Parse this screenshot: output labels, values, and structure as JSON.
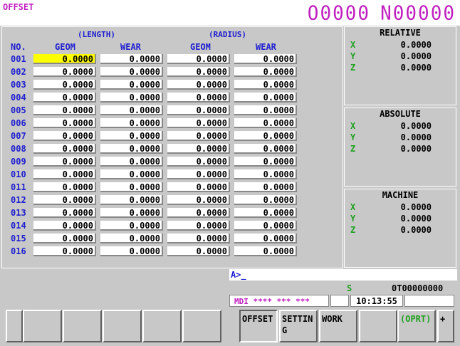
{
  "screen_title": "OFFSET",
  "program_number": "O0000",
  "sequence_number": "N00000",
  "headers": {
    "length": "(LENGTH)",
    "radius": "(RADIUS)",
    "no": "NO.",
    "geom1": "GEOM",
    "wear1": "WEAR",
    "geom2": "GEOM",
    "wear2": "WEAR"
  },
  "rows": [
    {
      "no": "001",
      "v": [
        "0.0000",
        "0.0000",
        "0.0000",
        "0.0000"
      ]
    },
    {
      "no": "002",
      "v": [
        "0.0000",
        "0.0000",
        "0.0000",
        "0.0000"
      ]
    },
    {
      "no": "003",
      "v": [
        "0.0000",
        "0.0000",
        "0.0000",
        "0.0000"
      ]
    },
    {
      "no": "004",
      "v": [
        "0.0000",
        "0.0000",
        "0.0000",
        "0.0000"
      ]
    },
    {
      "no": "005",
      "v": [
        "0.0000",
        "0.0000",
        "0.0000",
        "0.0000"
      ]
    },
    {
      "no": "006",
      "v": [
        "0.0000",
        "0.0000",
        "0.0000",
        "0.0000"
      ]
    },
    {
      "no": "007",
      "v": [
        "0.0000",
        "0.0000",
        "0.0000",
        "0.0000"
      ]
    },
    {
      "no": "008",
      "v": [
        "0.0000",
        "0.0000",
        "0.0000",
        "0.0000"
      ]
    },
    {
      "no": "009",
      "v": [
        "0.0000",
        "0.0000",
        "0.0000",
        "0.0000"
      ]
    },
    {
      "no": "010",
      "v": [
        "0.0000",
        "0.0000",
        "0.0000",
        "0.0000"
      ]
    },
    {
      "no": "011",
      "v": [
        "0.0000",
        "0.0000",
        "0.0000",
        "0.0000"
      ]
    },
    {
      "no": "012",
      "v": [
        "0.0000",
        "0.0000",
        "0.0000",
        "0.0000"
      ]
    },
    {
      "no": "013",
      "v": [
        "0.0000",
        "0.0000",
        "0.0000",
        "0.0000"
      ]
    },
    {
      "no": "014",
      "v": [
        "0.0000",
        "0.0000",
        "0.0000",
        "0.0000"
      ]
    },
    {
      "no": "015",
      "v": [
        "0.0000",
        "0.0000",
        "0.0000",
        "0.0000"
      ]
    },
    {
      "no": "016",
      "v": [
        "0.0000",
        "0.0000",
        "0.0000",
        "0.0000"
      ]
    }
  ],
  "panels": [
    {
      "title": "RELATIVE",
      "axes": [
        {
          "a": "X",
          "v": "0.0000"
        },
        {
          "a": "Y",
          "v": "0.0000"
        },
        {
          "a": "Z",
          "v": "0.0000"
        }
      ]
    },
    {
      "title": "ABSOLUTE",
      "axes": [
        {
          "a": "X",
          "v": "0.0000"
        },
        {
          "a": "Y",
          "v": "0.0000"
        },
        {
          "a": "Z",
          "v": "0.0000"
        }
      ]
    },
    {
      "title": "MACHINE",
      "axes": [
        {
          "a": "X",
          "v": "0.0000"
        },
        {
          "a": "Y",
          "v": "0.0000"
        },
        {
          "a": "Z",
          "v": "0.0000"
        }
      ]
    }
  ],
  "input_prompt": "A>_",
  "spindle_label": "S",
  "tool_info": "0T00000000",
  "mode": "MDI  **** *** ***",
  "time": "10:13:55",
  "softkeys": [
    "",
    "",
    "",
    "",
    "",
    "",
    "OFFSET",
    "SETTING",
    "WORK",
    "",
    "(OPRT)",
    "+"
  ],
  "colors": {
    "title": "#c020c0",
    "label": "#2020d0",
    "axis": "#20a020",
    "cursor": "#ffff00"
  }
}
